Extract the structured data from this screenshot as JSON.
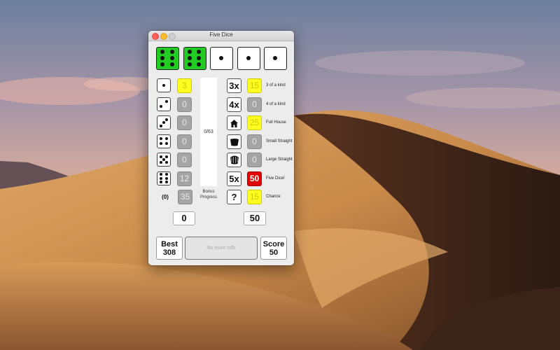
{
  "window": {
    "title": "Five Dice"
  },
  "dice": [
    {
      "value": 6,
      "held": true
    },
    {
      "value": 6,
      "held": true
    },
    {
      "value": 1,
      "held": false
    },
    {
      "value": 1,
      "held": false
    },
    {
      "value": 1,
      "held": false
    }
  ],
  "upper": [
    {
      "face": 1,
      "score": "3",
      "style": "yellow"
    },
    {
      "face": 2,
      "score": "0",
      "style": "gray"
    },
    {
      "face": 3,
      "score": "0",
      "style": "gray"
    },
    {
      "face": 4,
      "score": "0",
      "style": "gray"
    },
    {
      "face": 5,
      "score": "0",
      "style": "gray"
    },
    {
      "face": 6,
      "score": "12",
      "style": "gray"
    }
  ],
  "upper_bonus": {
    "label": "(0)",
    "score": "35"
  },
  "bonus": {
    "progress_text": "0/63",
    "label_line1": "Bonus",
    "label_line2": "Progress"
  },
  "lower": [
    {
      "button": "3x",
      "icon": "",
      "score": "15",
      "style": "yellow",
      "label": "3 of a kind"
    },
    {
      "button": "4x",
      "icon": "",
      "score": "0",
      "style": "gray",
      "label": "4 of a kind"
    },
    {
      "button": "",
      "icon": "house-icon",
      "score": "25",
      "style": "yellow",
      "label": "Full House"
    },
    {
      "button": "",
      "icon": "small-straight-icon",
      "score": "0",
      "style": "gray",
      "label": "Small Straight"
    },
    {
      "button": "",
      "icon": "large-straight-icon",
      "score": "0",
      "style": "gray",
      "label": "Large Straight"
    },
    {
      "button": "5x",
      "icon": "",
      "score": "50",
      "style": "red",
      "label": "Five Dice!"
    },
    {
      "button": "?",
      "icon": "",
      "score": "15",
      "style": "yellow",
      "label": "Chance"
    }
  ],
  "totals": {
    "upper_total": "0",
    "lower_total": "50"
  },
  "best": {
    "label": "Best",
    "value": "308"
  },
  "score": {
    "label": "Score",
    "value": "50"
  },
  "roll_button": {
    "label": "No more rolls"
  }
}
